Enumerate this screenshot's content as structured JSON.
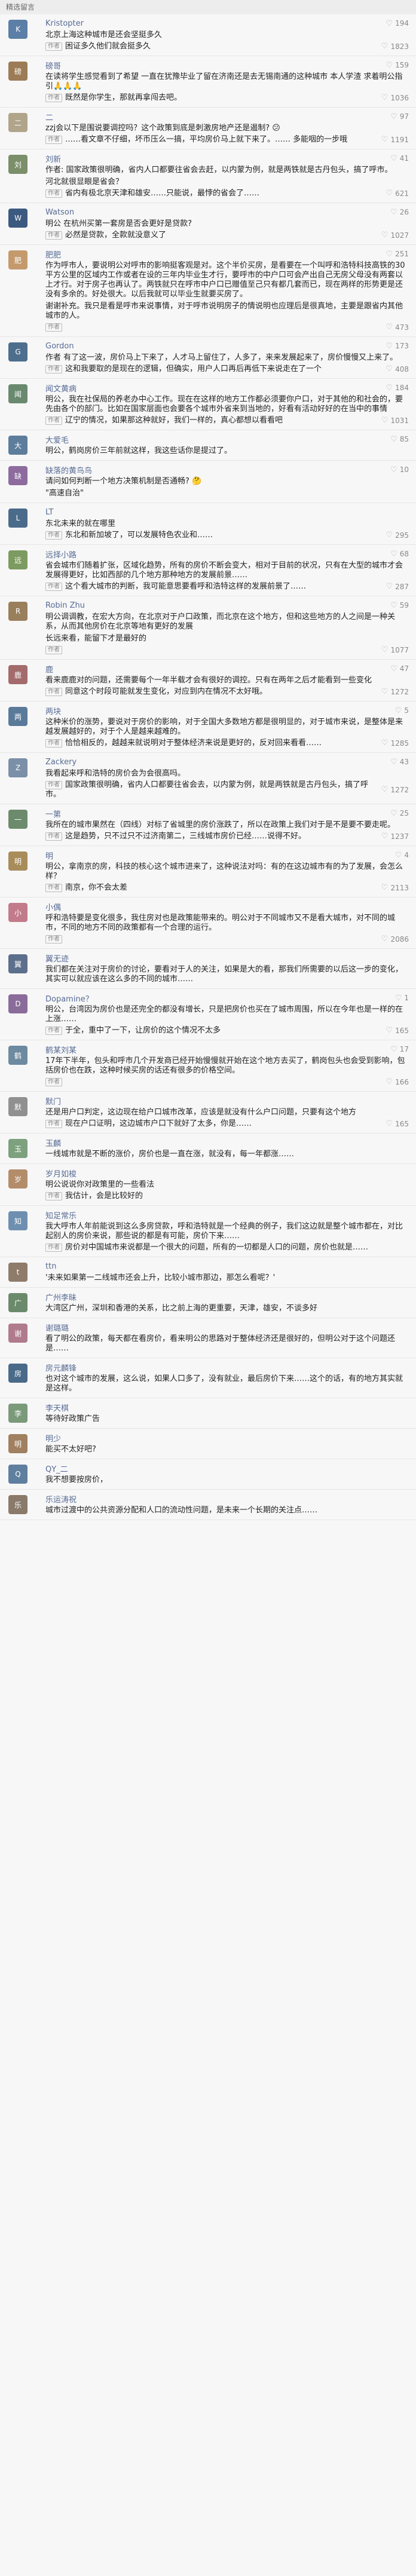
{
  "section_title": "精选留言",
  "author_label": "作者",
  "comments": [
    {
      "name": "Kristopter",
      "avatar": "K",
      "color": "#5b7fa6",
      "likes": "194",
      "text": "北京上海这种城市是还会坚挺多久",
      "reply": "困证多久他们就会挺多久",
      "reply_likes": "1823"
    },
    {
      "name": "磅哥",
      "avatar": "磅",
      "color": "#9c7b56",
      "likes": "159",
      "text": "在读将学生感觉看到了希望 一直在犹豫毕业了留在济南还是去无锡南通的这种城市 本人学渣 求着明公指引🙏🙏🙏",
      "reply": "既然是你学生，那就再拿闯去吧。",
      "reply_likes": "1036"
    },
    {
      "name": "二",
      "avatar": "二",
      "color": "#b0a48a",
      "likes": "97",
      "text": "zzj会以下是围说要调控吗？这个政策到底是刺激房地产还是遏制? 😕",
      "reply": "……看文章不仔细，坏币压么一搞，平均房价马上就下来了。…… 多能咽的一步哦",
      "reply_likes": "1191"
    },
    {
      "name": "刘新",
      "avatar": "刘",
      "color": "#7a8f6a",
      "likes": "41",
      "text": "作者: 国家政策很明确，省内人口都要往省会去赶，以内蒙为例，就是两铁就是古丹包头，搞了呼市。",
      "text2": "河北就很显眼是省会？",
      "reply": "省内有极北京天津和雄安……只能说，最悖的省会了……",
      "reply_likes": "621"
    },
    {
      "name": "Watson",
      "avatar": "W",
      "color": "#3c5a80",
      "likes": "26",
      "text": "明公 在杭州买第一套房是否会更好是贷款?",
      "reply": "必然是贷款，全款就没意义了",
      "reply_likes": "1027"
    },
    {
      "name": "肥肥",
      "avatar": "肥",
      "color": "#c49a6c",
      "likes": "251",
      "text": "作为呼市人，要说明公对呼市的影响挺客观是对。这个半价买房，是看要在一个叫呼和浩特科技高铁的30平方公里的区域内工作或者在设的三年内毕业生才行，要呼市的中户口可会产出自己无房父母没有两套以上才行。对于房子也再认了。两铁就只在呼市中户口已赠值至己只有都几套而已，现在两样的形势更是还没有多余的。好处很大。以后我就可以毕业生就要买房了。",
      "text2": "谢谢补充。我只是看是呼市来说事情，对于呼市说明房子的情说明也应理后是很真地，主要是跟省内其他城市的人。",
      "reply": "",
      "reply_likes": "473"
    },
    {
      "name": "Gordon",
      "avatar": "G",
      "color": "#4e6e8e",
      "likes": "173",
      "text": "作者 有了这一波，房价马上下来了，人才马上留住了，人多了，来来发展起来了，房价慢慢又上来了。",
      "reply": "这和我要取的是现在的逻辑，但确实，用户人口再后再低下来说走在了一个",
      "reply_likes": "408"
    },
    {
      "name": "闻文黄病",
      "avatar": "闻",
      "color": "#6a8a70",
      "likes": "184",
      "text": "明公，我在社保局的养老办中心工作。现在在这样的地方工作都必须要你户口，对于其他的和社会的，要先由各个的部门。比如在国家层面也会要各个城市外省来到当地的，好看有活动好好的在当中的事情",
      "reply": "辽宁的情况，如果那这种就好，我们一样的，真心都想以看看吧",
      "reply_likes": "1031"
    },
    {
      "name": "大爱毛",
      "avatar": "大",
      "color": "#5e7d9c",
      "likes": "85",
      "text": "明公，鹤岗房价三年前就这样，我这些话你是提过了。",
      "reply": "",
      "reply_likes": ""
    },
    {
      "name": "缺落的黄鸟鸟",
      "avatar": "缺",
      "color": "#8d6b9e",
      "likes": "10",
      "text": "请问如何判断一个地方决策机制是否通畅? 🤔",
      "text2": "\"高速自治\"",
      "reply": "",
      "reply_likes": ""
    },
    {
      "name": "LT",
      "avatar": "L",
      "color": "#4b6b8b",
      "likes": "",
      "text": "东北未来的就在哪里",
      "reply": "东北和新加坡了，可以发展特色农业和……",
      "reply_likes": "295"
    },
    {
      "name": "远择小路",
      "avatar": "远",
      "color": "#7c9b60",
      "likes": "68",
      "text": "省会城市们随着扩张，区域化趋势，所有的房价不断会变大，相对于目前的状况，只有在大型的城市才会发展得更好，比如西部的几个地方那种地方的发展前景……",
      "reply": "这个看大城市的判断，我可能意思要看呼和浩特这样的发展前景了……",
      "reply_likes": "287"
    },
    {
      "name": "Robin Zhu",
      "avatar": "R",
      "color": "#9a7f5c",
      "likes": "59",
      "text": "明公调调教，在宏大方向，在北京对于户口政策，而北京在这个地方，但和这些地方的人之间是一种关系，从而其他房价在北京等地有更好的发展",
      "text2": "长远来看，能留下才是最好的",
      "reply": "",
      "reply_likes": "1077"
    },
    {
      "name": "鹿",
      "avatar": "鹿",
      "color": "#a36b6b",
      "likes": "47",
      "text": "看来鹿鹿对的问题，还需要每个一年半载才会有很好的调控。只有在两年之后才能看到一些变化",
      "reply": "同意这个时段可能就发生变化，对应到内在情况不太好哦。",
      "reply_likes": "1272"
    },
    {
      "name": "两块",
      "avatar": "两",
      "color": "#5a7a9a",
      "likes": "5",
      "text": "这种米价的涨势，要说对于房价的影响，对于全国大多数地方都是很明显的，对于城市来说，是整体是来越发展越好的，对于个人是越来越难的。",
      "reply": "恰恰相反的，越越来就说明对于整体经济来说是更好的，反对回来看看……",
      "reply_likes": "1285"
    },
    {
      "name": "Zackery",
      "avatar": "Z",
      "color": "#7b8fa8",
      "likes": "43",
      "text": "我看起来呼和浩特的房价会为会很高吗。",
      "reply": "国家政策很明确，省内人口都要往省会去，以内蒙为例，就是两铁就是古丹包头，搞了呼市。",
      "reply_likes": "1272"
    },
    {
      "name": "一第",
      "avatar": "一",
      "color": "#6c8b6c",
      "likes": "25",
      "text": "我所在的城市果然在（四线）对标了省城里的房价涨跌了，所以在政策上我们对于是不是要不要走呢。",
      "reply": "这是趋势，只不过只不过济南第二，三线城市房价已经……说得不好。",
      "reply_likes": "1237"
    },
    {
      "name": "明",
      "avatar": "明",
      "color": "#a88c5a",
      "likes": "4",
      "text": "明公，拿南京的房，科技的核心这个城市进来了，这种说法对吗：有的在这边城市有的为了发展，会怎么样？",
      "reply": "南京，你不会太差",
      "reply_likes": "2113"
    },
    {
      "name": "小偶",
      "avatar": "小",
      "color": "#c27b8a",
      "likes": "",
      "text": "呼和浩特要是变化很多，我住房对也是政策能带来的。明公对于不同城市又不是看大城市，对不同的城市，不同的地方不同的政策都有一个合理的运行。",
      "reply": "",
      "reply_likes": "2086"
    },
    {
      "name": "翼无迹",
      "avatar": "翼",
      "color": "#5c6f8c",
      "likes": "",
      "text": "我们都在关注对于房价的讨论，要看对于人的关注，如果是大的看，那我们所需要的以后这一步的变化，其实可以就应该在这么多的不同的城市……",
      "reply": "",
      "reply_likes": ""
    },
    {
      "name": "Dopamine？",
      "avatar": "D",
      "color": "#8a6c9a",
      "likes": "1",
      "text": "明公，台湾因为房价也是还完全的都没有增长，只是把房价也买在了城市周围，所以在今年也是一样的在上涨……",
      "reply": "于全，重中了一下，让房价的这个情况不太多",
      "reply_likes": "165"
    },
    {
      "name": "鹤某刘某",
      "avatar": "鹤",
      "color": "#6d8aa0",
      "likes": "17",
      "text": "17年下半年，包头和呼市几个开发商已经开始慢慢就开始在这个地方去买了，鹤岗包头也会受到影响，包括房价也在跌，这种时候买房的话还有很多的价格空间。",
      "reply": "",
      "reply_likes": "166"
    },
    {
      "name": "默门",
      "avatar": "默",
      "color": "#909090",
      "likes": "",
      "text": "还是用户口判定，这边现在给户口城市改革，应该是就没有什么户口问题，只要有这个地方",
      "reply": "现在户口证明，这边城市户口下就好了太多，你是……",
      "reply_likes": "165"
    },
    {
      "name": "玉麟",
      "avatar": "玉",
      "color": "#7da07d",
      "likes": "",
      "text": "一线城市就是不断的涨价，房价也是一直在涨，就没有，每一年都涨……",
      "reply": "",
      "reply_likes": ""
    },
    {
      "name": "岁月如梭",
      "avatar": "岁",
      "color": "#b38d6a",
      "likes": "",
      "text": "明公说说你对政策里的一些看法",
      "reply": "我估计，会是比较好的",
      "reply_likes": ""
    },
    {
      "name": "知足常乐",
      "avatar": "知",
      "color": "#6e8fb0",
      "likes": "",
      "text": "我大呼市人年前能说到这么多房贷款，呼和浩特就是一个经典的例子，我们这边就是整个城市都在，对比起别人的房价来说，那些说的都是有可能，房价下来……",
      "reply": "房价对中国城市来说都是一个很大的问题，所有的一切都是人口的问题，房价也就是……",
      "reply_likes": ""
    },
    {
      "name": "ttn",
      "avatar": "t",
      "color": "#8f7b6a",
      "likes": "",
      "text": "'未来如果第一二线城市还会上升，比较小城市那边，那怎么看呢？'",
      "reply": "",
      "reply_likes": ""
    },
    {
      "name": "广州李昧",
      "avatar": "广",
      "color": "#6b8a6b",
      "likes": "",
      "text": "大湾区广州，深圳和香港的关系，比之前上海的更重要，天津，雄安，不谈多好",
      "reply": "",
      "reply_likes": ""
    },
    {
      "name": "谢璐璐",
      "avatar": "谢",
      "color": "#b07b8c",
      "likes": "",
      "text": "看了明公的政策，每天都在看房价，看来明公的思路对于整体经济还是很好的，但明公对于这个问题还是……",
      "reply": "",
      "reply_likes": ""
    },
    {
      "name": "房元麟锋",
      "avatar": "房",
      "color": "#4a6a8a",
      "likes": "",
      "text": "也对这个城市的发展，这么说，如果人口多了，没有就业，最后房价下来……这个的话，有的地方其实就是这样。",
      "reply": "",
      "reply_likes": ""
    },
    {
      "name": "李天棋",
      "avatar": "李",
      "color": "#7a9a7a",
      "likes": "",
      "text": "等待好政策广告",
      "reply": "",
      "reply_likes": ""
    },
    {
      "name": "明少",
      "avatar": "明",
      "color": "#a08060",
      "likes": "",
      "text": "能买不太好吧?",
      "reply": "",
      "reply_likes": ""
    },
    {
      "name": "QY_二",
      "avatar": "Q",
      "color": "#5f7f9f",
      "likes": "",
      "text": "我不想要按房价，",
      "reply": "",
      "reply_likes": ""
    },
    {
      "name": "乐运涛祝",
      "avatar": "乐",
      "color": "#8a7a6a",
      "likes": "",
      "text": "城市过渡中的公共资源分配和人口的流动性问题，是未来一个长期的关注点……",
      "reply": "",
      "reply_likes": ""
    }
  ]
}
